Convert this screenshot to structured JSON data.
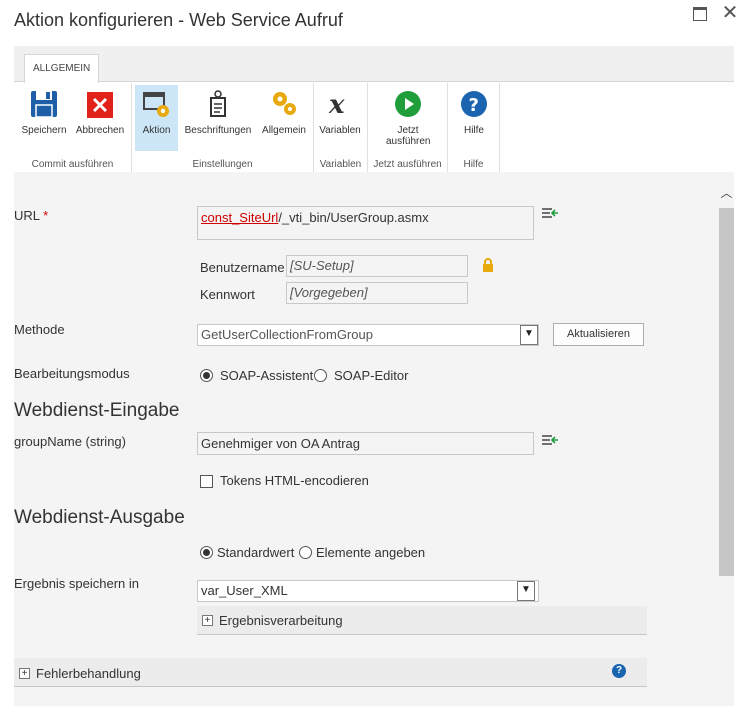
{
  "window": {
    "title": "Aktion konfigurieren - Web Service Aufruf"
  },
  "ribbon": {
    "tab": "ALLGEMEIN",
    "groups": [
      {
        "label": "Commit ausführen",
        "buttons": [
          {
            "label": "Speichern",
            "icon": "save-icon"
          },
          {
            "label": "Abbrechen",
            "icon": "cancel-icon"
          }
        ]
      },
      {
        "label": "Einstellungen",
        "buttons": [
          {
            "label": "Aktion",
            "icon": "action-gear-icon"
          },
          {
            "label": "Beschriftungen",
            "icon": "label-tag-icon"
          },
          {
            "label": "Allgemein",
            "icon": "gears-icon"
          }
        ]
      },
      {
        "label": "Variablen",
        "buttons": [
          {
            "label": "Variablen",
            "icon": "variable-x-icon"
          }
        ]
      },
      {
        "label": "Jetzt ausführen",
        "buttons": [
          {
            "label": "Jetzt ausführen",
            "icon": "play-icon"
          }
        ]
      },
      {
        "label": "Hilfe",
        "buttons": [
          {
            "label": "Hilfe",
            "icon": "help-icon"
          }
        ]
      }
    ],
    "active_button": "Aktion"
  },
  "form": {
    "url": {
      "label": "URL",
      "required_mark": "*",
      "token": "const_SiteUrl",
      "rest": "/_vti_bin/UserGroup.asmx"
    },
    "username": {
      "label": "Benutzername",
      "value": "[SU-Setup]"
    },
    "password": {
      "label": "Kennwort",
      "value": "[Vorgegeben]"
    },
    "method": {
      "label": "Methode",
      "value": "GetUserCollectionFromGroup",
      "refresh_button": "Aktualisieren"
    },
    "edit_mode": {
      "label": "Bearbeitungsmodus",
      "options": [
        "SOAP-Assistent",
        "SOAP-Editor"
      ],
      "selected": "SOAP-Assistent"
    },
    "input_section": {
      "title": "Webdienst-Eingabe"
    },
    "group_name": {
      "label": "groupName (string)",
      "value": "Genehmiger von OA Antrag"
    },
    "encode_tokens": {
      "label": "Tokens HTML-encodieren",
      "checked": false
    },
    "output_section": {
      "title": "Webdienst-Ausgabe"
    },
    "output_mode": {
      "options": [
        "Standardwert",
        "Elemente angeben"
      ],
      "selected": "Standardwert"
    },
    "store_result": {
      "label": "Ergebnis speichern in",
      "value": "var_User_XML"
    },
    "result_processing": {
      "label": "Ergebnisverarbeitung"
    },
    "error_handling": {
      "label": "Fehlerbehandlung"
    }
  },
  "colors": {
    "accent_active": "#cde6f7",
    "required": "#cc0000",
    "help_blue": "#1a64b0",
    "play_green": "#1f9d3a"
  }
}
